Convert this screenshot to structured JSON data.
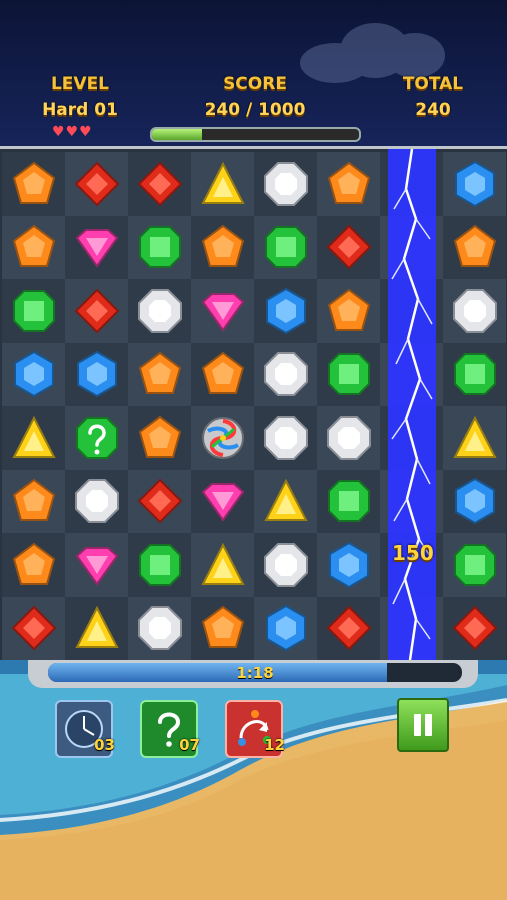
{
  "header": {
    "level_label": "LEVEL",
    "level_value": "Hard 01",
    "score_label": "SCORE",
    "score_value": "240 / 1000",
    "total_label": "TOTAL",
    "total_value": "240",
    "lives": 3,
    "score_progress_fraction": 0.24
  },
  "board": {
    "rows": [
      [
        "orange",
        "red",
        "red",
        "yellow",
        "white",
        "orange",
        "lightning",
        "blue"
      ],
      [
        "orange",
        "pink",
        "green",
        "orange",
        "green",
        "red",
        "lightning",
        "orange"
      ],
      [
        "green",
        "red",
        "white",
        "pink",
        "blue",
        "orange",
        "lightning",
        "white"
      ],
      [
        "blue",
        "blue",
        "orange",
        "orange",
        "white",
        "green",
        "lightning",
        "green"
      ],
      [
        "yellow",
        "hint",
        "orange",
        "rainbow",
        "white",
        "white",
        "lightning",
        "yellow"
      ],
      [
        "orange",
        "white",
        "red",
        "pink",
        "yellow",
        "green",
        "lightning",
        "blue"
      ],
      [
        "orange",
        "pink",
        "green",
        "yellow",
        "white",
        "blue",
        "lightning",
        "green"
      ],
      [
        "red",
        "yellow",
        "white",
        "orange",
        "blue",
        "red",
        "lightning",
        "red"
      ]
    ],
    "bonus_text": "150",
    "colors": {
      "orange": "#ff8a1c",
      "red": "#e02a1a",
      "yellow": "#ffd21a",
      "white": "#e4e6ea",
      "blue": "#2a8ff0",
      "green": "#23c23a",
      "pink": "#ff3fb0",
      "lightning": "#3a45ff"
    }
  },
  "footer": {
    "timer_text": "1:18",
    "timer_fraction": 0.82,
    "powerups": [
      {
        "icon": "clock-icon",
        "count": "03"
      },
      {
        "icon": "question-icon",
        "count": "07"
      },
      {
        "icon": "shuffle-icon",
        "count": "12"
      }
    ],
    "pause_icon": "pause-icon"
  }
}
